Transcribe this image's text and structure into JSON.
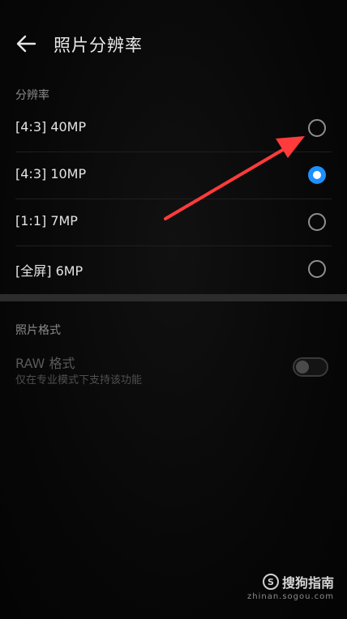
{
  "header": {
    "title": "照片分辨率",
    "back_icon": "arrow-left-icon"
  },
  "resolution_section": {
    "title": "分辨率",
    "options": [
      {
        "label": "[4:3] 40MP",
        "selected": false
      },
      {
        "label": "[4:3] 10MP",
        "selected": true
      },
      {
        "label": "[1:1] 7MP",
        "selected": false
      },
      {
        "label": "[全屏] 6MP",
        "selected": false
      }
    ]
  },
  "format_section": {
    "title": "照片格式",
    "raw": {
      "title": "RAW 格式",
      "subtitle": "仅在专业模式下支持该功能",
      "enabled": false,
      "toggle_on": false
    }
  },
  "annotation": {
    "color": "#ff3b3b"
  },
  "watermark": {
    "name": "搜狗指南",
    "url": "zhinan.sogou.com"
  },
  "colors": {
    "accent": "#1e90ff",
    "background": "#070707"
  }
}
